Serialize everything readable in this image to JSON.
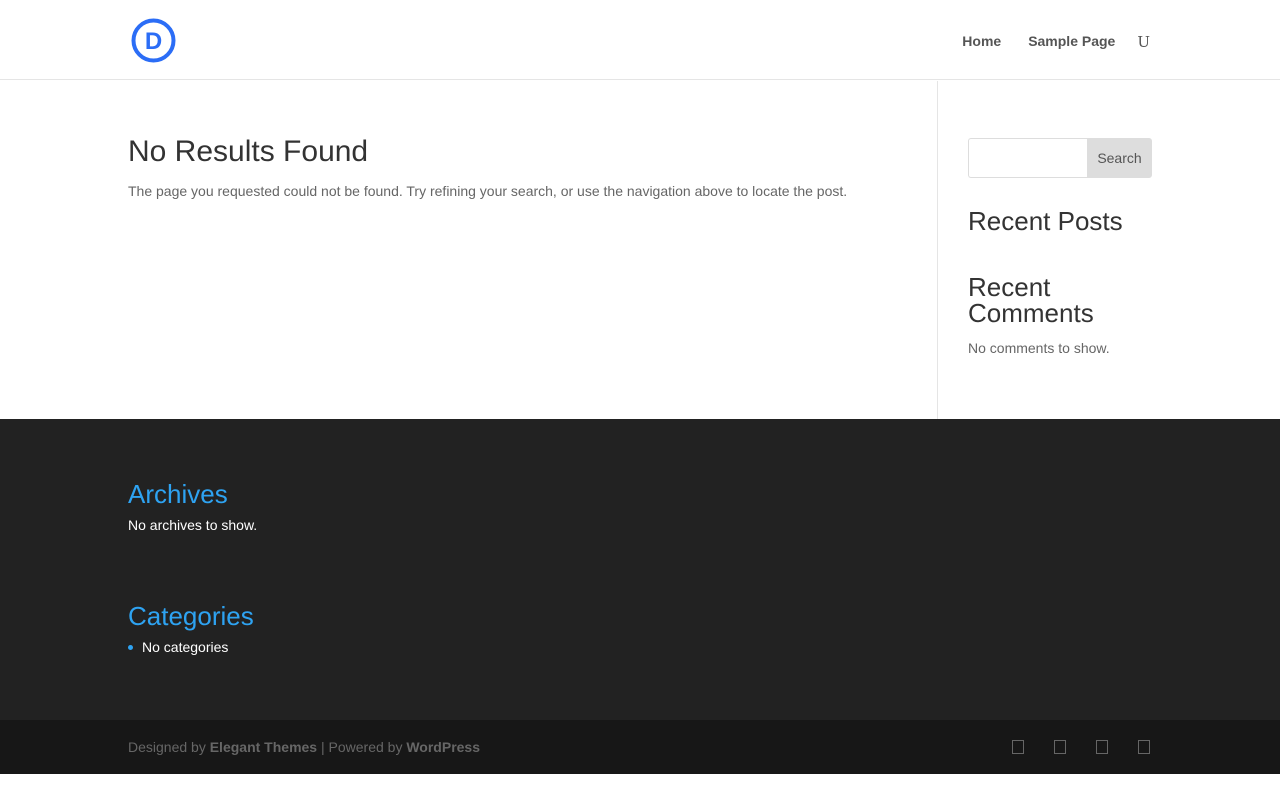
{
  "header": {
    "logo_letter": "D",
    "nav": [
      {
        "label": "Home"
      },
      {
        "label": "Sample Page"
      }
    ],
    "nav_glyph": "U"
  },
  "main": {
    "title": "No Results Found",
    "message": "The page you requested could not be found. Try refining your search, or use the navigation above to locate the post."
  },
  "sidebar": {
    "search": {
      "placeholder": "",
      "value": "",
      "button_label": "Search"
    },
    "recent_posts_title": "Recent Posts",
    "recent_comments_title": "Recent Comments",
    "recent_comments_text": "No comments to show."
  },
  "footer": {
    "archives_title": "Archives",
    "archives_text": "No archives to show.",
    "categories_title": "Categories",
    "categories": [
      "No categories"
    ]
  },
  "bottom": {
    "designed_by": "Designed by",
    "elegant_themes": "Elegant Themes",
    "separator": "| Powered by",
    "wordpress": "WordPress",
    "social_icons": [
      "social-icon",
      "social-icon",
      "social-icon",
      "social-icon"
    ]
  },
  "colors": {
    "accent": "#2ea3f2",
    "logo": "#2b6df6",
    "footer_bg": "#222222",
    "bottom_bg": "#171717"
  }
}
